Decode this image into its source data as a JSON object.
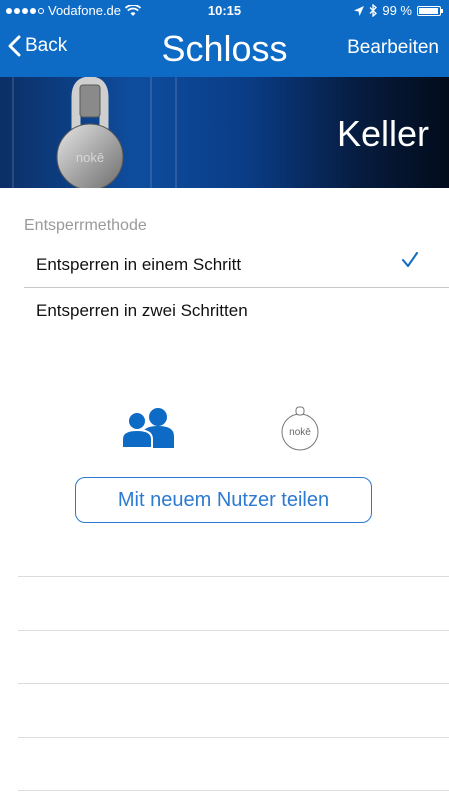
{
  "status_bar": {
    "carrier": "Vodafone.de",
    "time": "10:15",
    "battery": "99 %",
    "battery_level": 0.99
  },
  "nav": {
    "back_label": "Back",
    "title": "Schloss",
    "edit_label": "Bearbeiten"
  },
  "banner": {
    "lock_name": "Keller",
    "lock_brand": "nokē"
  },
  "unlock_method": {
    "section_label": "Entsperrmethode",
    "options": [
      {
        "label": "Entsperren in einem Schritt",
        "selected": true
      },
      {
        "label": "Entsperren in zwei Schritten",
        "selected": false
      }
    ]
  },
  "share": {
    "fob_brand": "nokē",
    "button_label": "Mit neuem Nutzer teilen"
  },
  "icons": {
    "back": "chevron-left-icon",
    "wifi": "wifi-icon",
    "location": "location-arrow-icon",
    "bluetooth": "bluetooth-icon",
    "battery": "battery-icon",
    "check": "checkmark-icon",
    "users": "users-icon",
    "fob": "noke-fob-icon"
  },
  "colors": {
    "accent": "#0e6bc5",
    "button_border": "#2d7bd0",
    "section_text": "#9a9a9a"
  }
}
